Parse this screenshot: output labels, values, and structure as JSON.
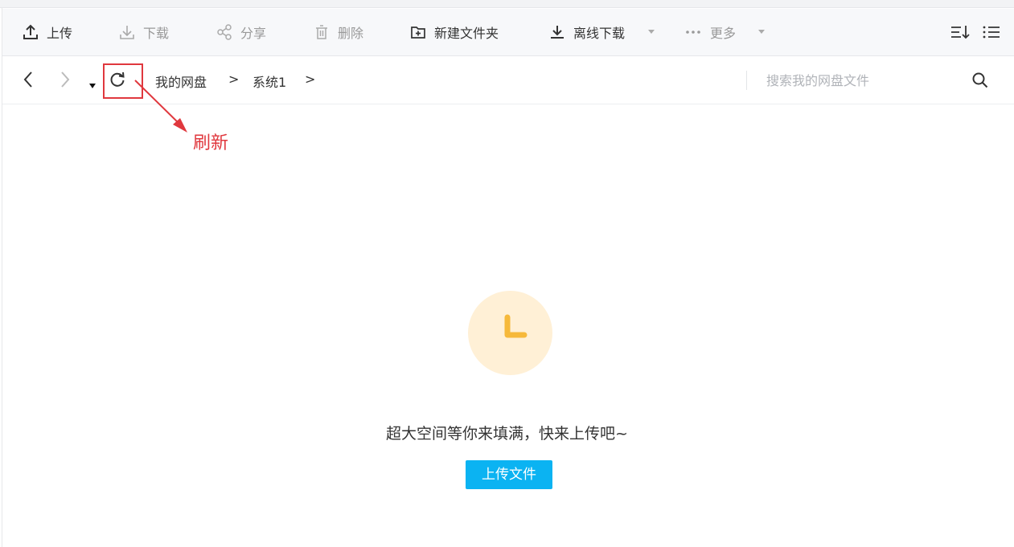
{
  "toolbar": {
    "upload": "上传",
    "download": "下载",
    "share": "分享",
    "delete": "删除",
    "new_folder": "新建文件夹",
    "offline_download": "离线下载",
    "more": "更多"
  },
  "nav": {
    "breadcrumbs": [
      "我的网盘",
      "系统1"
    ],
    "separator": ">",
    "search_placeholder": "搜索我的网盘文件"
  },
  "annotation": {
    "label": "刷新",
    "color": "#e0383e"
  },
  "empty_state": {
    "message": "超大空间等你来填满，快来上传吧~",
    "button": "上传文件",
    "button_color": "#0bb3f2",
    "icon_bg": "#fff0d6",
    "icon_fg": "#f6b93b"
  }
}
